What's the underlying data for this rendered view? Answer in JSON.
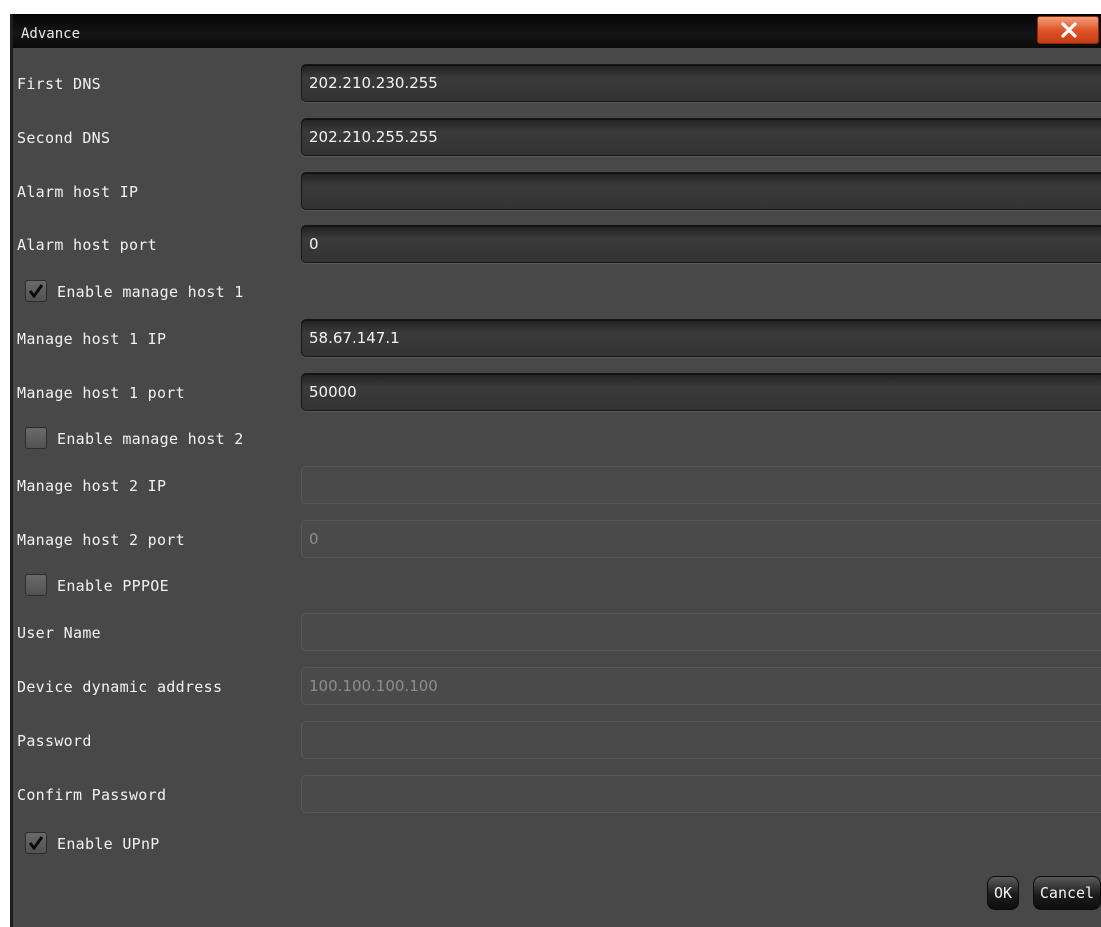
{
  "window": {
    "title": "Advance",
    "close_icon": "close-icon"
  },
  "fields": {
    "first_dns": {
      "label": "First DNS",
      "value": "202.210.230.255"
    },
    "second_dns": {
      "label": "Second DNS",
      "value": "202.210.255.255"
    },
    "alarm_host_ip": {
      "label": "Alarm host IP",
      "value": ""
    },
    "alarm_host_port": {
      "label": "Alarm host port",
      "value": "0"
    },
    "manage_host1_ip": {
      "label": "Manage host 1 IP",
      "value": "58.67.147.1"
    },
    "manage_host1_port": {
      "label": "Manage host 1 port",
      "value": "50000"
    },
    "manage_host2_ip": {
      "label": "Manage host 2 IP",
      "value": ""
    },
    "manage_host2_port": {
      "label": "Manage host 2 port",
      "value": "0"
    },
    "user_name": {
      "label": "User Name",
      "value": ""
    },
    "device_dynamic_address": {
      "label": "Device dynamic address",
      "value": "100.100.100.100"
    },
    "password": {
      "label": "Password",
      "value": ""
    },
    "confirm_password": {
      "label": "Confirm Password",
      "value": ""
    }
  },
  "checkboxes": {
    "enable_manage_host1": {
      "label": "Enable manage host 1",
      "checked": true
    },
    "enable_manage_host2": {
      "label": "Enable manage host 2",
      "checked": false
    },
    "enable_pppoe": {
      "label": "Enable PPPOE",
      "checked": false
    },
    "enable_upnp": {
      "label": "Enable UPnP",
      "checked": true
    }
  },
  "buttons": {
    "ok": "OK",
    "cancel": "Cancel"
  }
}
